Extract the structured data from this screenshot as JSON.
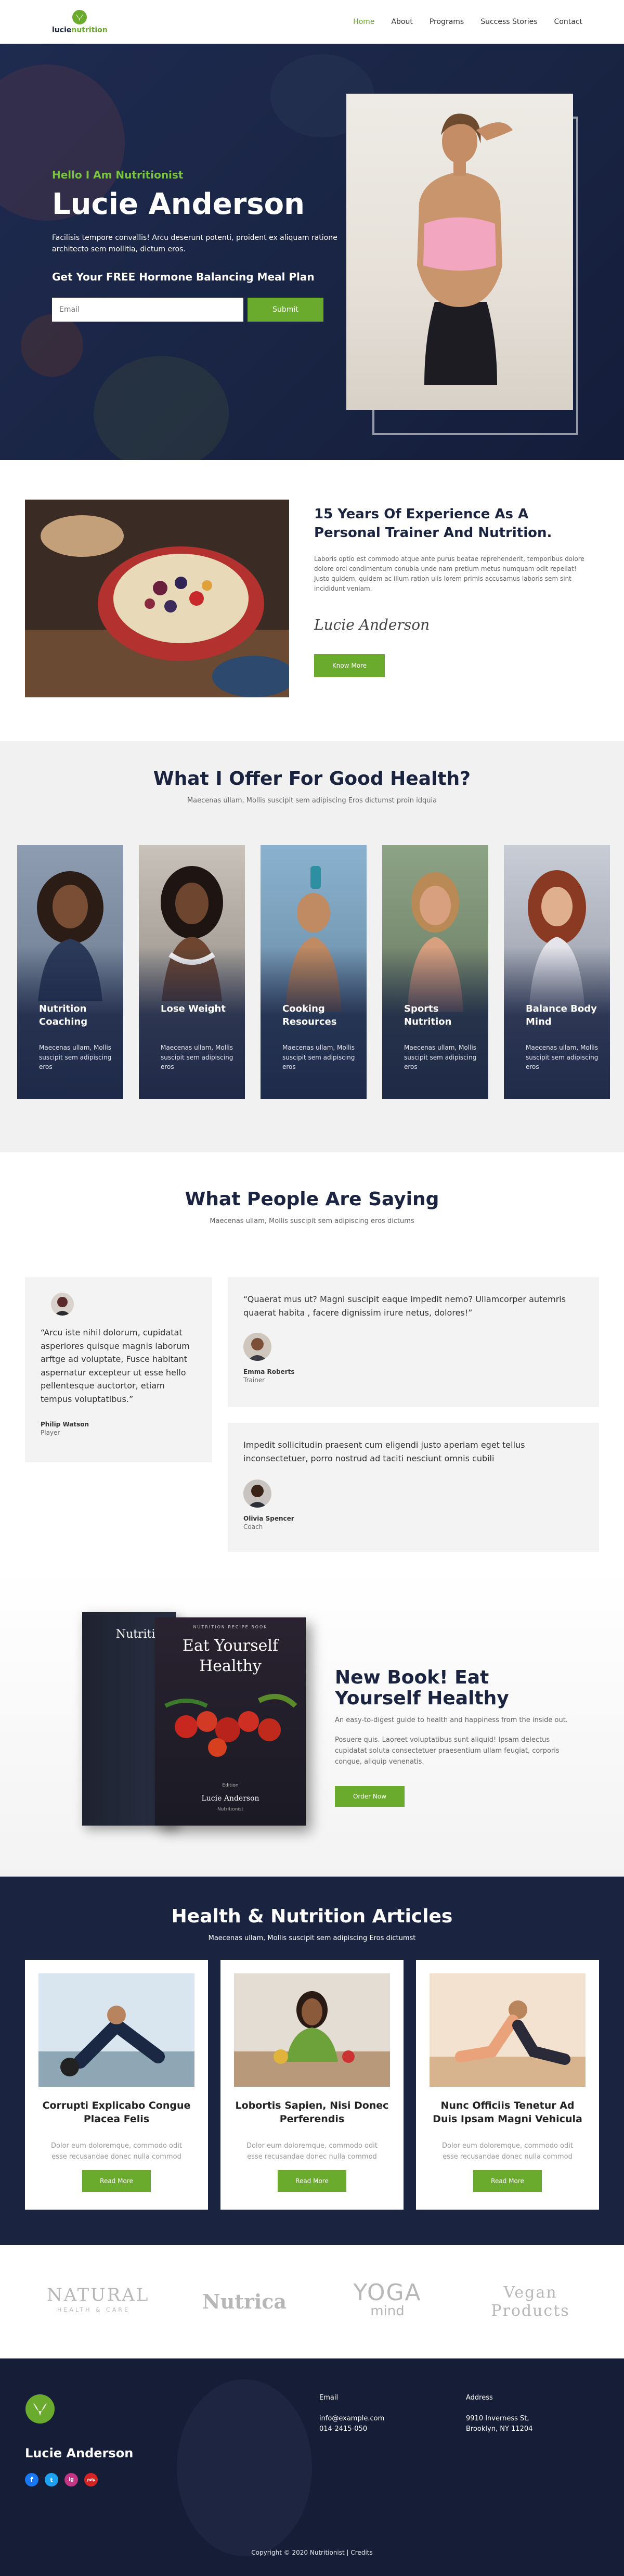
{
  "brand": {
    "logo_prefix": "lucie",
    "logo_suffix": "nutrition",
    "colors": {
      "accent": "#6aaa2c",
      "navy": "#1a2340"
    }
  },
  "nav": [
    {
      "label": "Home",
      "active": true
    },
    {
      "label": "About"
    },
    {
      "label": "Programs"
    },
    {
      "label": "Success Stories"
    },
    {
      "label": "Contact"
    }
  ],
  "hero": {
    "kicker": "Hello I Am Nutritionist",
    "title": "Lucie Anderson",
    "desc": "Facilisis tempore convallis! Arcu deserunt potenti, proident ex aliquam ratione architecto sem mollitia, dictum eros.",
    "cta": "Get Your FREE Hormone Balancing Meal Plan",
    "email_placeholder": "Email",
    "submit_label": "Submit"
  },
  "about": {
    "title": "15 Years Of Experience As A Personal Trainer And Nutrition.",
    "text": "Laboris optio est commodo atque ante purus beatae reprehenderit, temporibus dolore dolore orci condimentum conubia unde nam pretium metus numquam odit repellat! Justo quidem, quidem ac illum ration ulis lorem primis accusamus laboris sem sint incididunt veniam.",
    "signature": "Lucie Anderson",
    "button": "Know More"
  },
  "offer": {
    "title": "What I Offer For Good Health?",
    "subtitle": "Maecenas ullam, Mollis suscipit sem adipiscing Eros dictumst proin idquia",
    "cards": [
      {
        "title": "Nutrition Coaching",
        "text": "Maecenas ullam, Mollis suscipit sem adipiscing eros"
      },
      {
        "title": "Lose Weight",
        "text": "Maecenas ullam, Mollis suscipit sem adipiscing eros"
      },
      {
        "title": "Cooking Resources",
        "text": "Maecenas ullam, Mollis suscipit sem adipiscing eros"
      },
      {
        "title": "Sports Nutrition",
        "text": "Maecenas ullam, Mollis suscipit sem adipiscing eros"
      },
      {
        "title": "Balance Body Mind",
        "text": "Maecenas ullam, Mollis suscipit sem adipiscing eros"
      }
    ]
  },
  "testimonials": {
    "title": "What People Are Saying",
    "subtitle": "Maecenas ullam, Mollis suscipit sem adipiscing eros dictums",
    "items": [
      {
        "quote": "“Arcu iste nihil dolorum, cupidatat asperiores quisque magnis laborum arftge ad voluptate, Fusce habitant aspernatur excepteur ut esse hello pellentesque auctortor, etiam tempus voluptatibus.”",
        "name": "Philip Watson",
        "role": "Player"
      },
      {
        "quote": "“Quaerat mus ut? Magni suscipit eaque impedit nemo? Ullamcorper autemris quaerat habita , facere dignissim irure netus, dolores!”",
        "name": "Emma Roberts",
        "role": "Trainer"
      },
      {
        "quote": "Impedit sollicitudin praesent cum eligendi justo aperiam eget tellus inconsectetuer, porro nostrud ad taciti nesciunt omnis cubili",
        "name": "Olivia Spencer",
        "role": "Coach"
      }
    ]
  },
  "book": {
    "cover_back_title": "Nutrition",
    "cover_kicker": "NUTRITION RECIPE BOOK",
    "cover_title": "Eat Yourself Healthy",
    "cover_author": "Lucie Anderson",
    "cover_edition": "Edition",
    "cover_publisher": "Nutritionist",
    "title": "New Book! Eat Yourself Healthy",
    "lead": "An easy-to-digest guide to health and happiness from the inside out.",
    "body": "Posuere quis. Laoreet voluptatibus sunt aliquid! Ipsam delectus cupidatat soluta consectetuer praesentium ullam feugiat, corporis congue, aliquip venenatis.",
    "button": "Order Now"
  },
  "articles": {
    "title": "Health & Nutrition Articles",
    "subtitle": "Maecenas ullam, Mollis suscipit sem adipiscing Eros dictumst",
    "items": [
      {
        "title": "Corrupti Explicabo Congue Placea Felis",
        "text": "Dolor eum doloremque, commodo odit esse recusandae donec nulla commod",
        "button": "Read More"
      },
      {
        "title": "Lobortis Sapien, Nisi Donec Perferendis",
        "text": "Dolor eum doloremque, commodo odit esse recusandae donec nulla commod",
        "button": "Read More"
      },
      {
        "title": "Nunc Officiis Tenetur Ad Duis Ipsam Magni Vehicula",
        "text": "Dolor eum doloremque, commodo odit esse recusandae donec nulla commod",
        "button": "Read More"
      }
    ]
  },
  "partners": [
    {
      "line1": "NATURAL",
      "line2": "HEALTH & CARE"
    },
    {
      "line1": "Nutrica",
      "line2": ""
    },
    {
      "line1": "YOGA",
      "line2": "mind"
    },
    {
      "line1": "Vegan",
      "line2": "Products"
    }
  ],
  "footer": {
    "name": "Lucie Anderson",
    "email_heading": "Email",
    "email": "info@example.com",
    "phone": "014-2415-050",
    "address_heading": "Address",
    "address1": "9910 Inverness St,",
    "address2": "Brooklyn, NY 11204",
    "social": [
      "f",
      "t",
      "ig",
      "yelp"
    ],
    "copyright": "Copyright © 2020 Nutritionist | Credits"
  }
}
